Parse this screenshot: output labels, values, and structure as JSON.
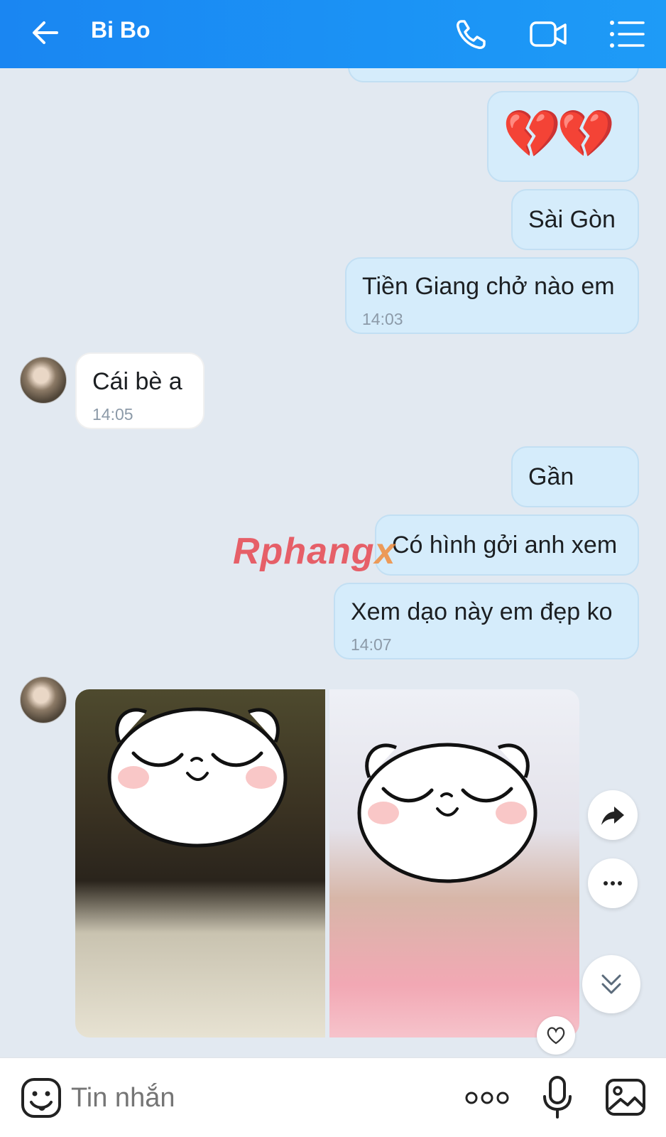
{
  "header": {
    "title": "Bi Bo",
    "icons": [
      "back-arrow-icon",
      "phone-icon",
      "video-call-icon",
      "menu-list-icon"
    ]
  },
  "messages": [
    {
      "side": "me",
      "type": "emoji",
      "content": "💔💔"
    },
    {
      "side": "me",
      "text": "Sài Gòn"
    },
    {
      "side": "me",
      "text": "Tiền Giang chở nào em",
      "time": "14:03"
    },
    {
      "side": "them",
      "text": "Cái bè a",
      "time": "14:05"
    },
    {
      "side": "me",
      "text": "Gần"
    },
    {
      "side": "me",
      "text": "Có hình gởi anh xem"
    },
    {
      "side": "me",
      "text": "Xem dạo này em đẹp ko",
      "time": "14:07"
    },
    {
      "side": "them",
      "type": "photos",
      "count": 2
    }
  ],
  "watermark": {
    "main": "Rphang",
    "suffix": "x"
  },
  "composer": {
    "placeholder": "Tin nhắn",
    "icons": [
      "sticker-icon",
      "more-icon",
      "microphone-icon",
      "image-icon"
    ]
  },
  "colors": {
    "header": "#1a86f2",
    "background": "#e2e9f1",
    "my_bubble": "#d5ecfb",
    "their_bubble": "#ffffff"
  }
}
